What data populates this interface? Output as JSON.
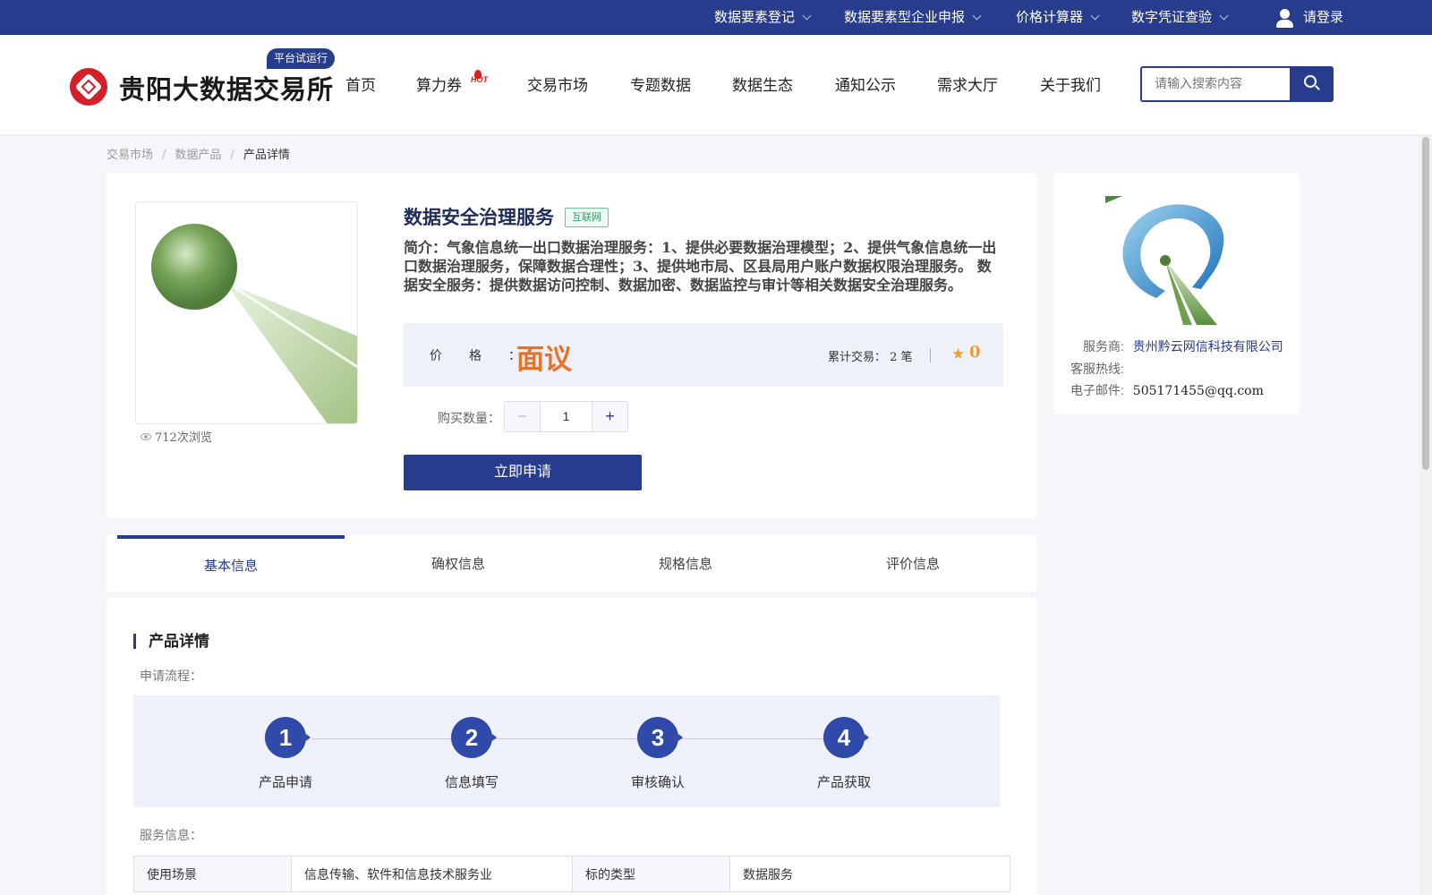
{
  "topbar": {
    "items": [
      {
        "label": "数据要素登记"
      },
      {
        "label": "数据要素型企业申报"
      },
      {
        "label": "价格计算器"
      },
      {
        "label": "数字凭证查验"
      }
    ],
    "login": "请登录"
  },
  "header": {
    "logo_text": "贵阳大数据交易所",
    "trial_badge": "平台试运行",
    "nav": [
      "首页",
      "算力券",
      "交易市场",
      "专题数据",
      "数据生态",
      "通知公示",
      "需求大厅",
      "关于我们"
    ],
    "hot_tag": "HOT",
    "search_placeholder": "请输入搜索内容"
  },
  "breadcrumb": [
    "交易市场",
    "数据产品",
    "产品详情"
  ],
  "product": {
    "title": "数据安全治理服务",
    "tag": "互联网",
    "description": "简介：气象信息统一出口数据治理服务：1、提供必要数据治理模型；2、提供气象信息统一出口数据治理服务，保障数据合理性；3、提供地市局、区县局用户账户数据权限治理服务。 数据安全服务：提供数据访问控制、数据加密、数据监控与审计等相关数据安全治理服务。",
    "price_label": "价格：",
    "price_value": "面议",
    "trade_count": "累计交易：  2 笔",
    "rating": "0",
    "qty_label": "购买数量：",
    "qty_value": "1",
    "views": "712次浏览",
    "apply_button": "立即申请"
  },
  "provider": {
    "name_label": "服务商:",
    "name": "贵州黔云网信科技有限公司",
    "hotline_label": "客服热线:",
    "hotline": "",
    "email_label": "电子邮件:",
    "email": "505171455@qq.com"
  },
  "tabs": [
    {
      "label": "基本信息",
      "active": true
    },
    {
      "label": "确权信息",
      "active": false
    },
    {
      "label": "规格信息",
      "active": false
    },
    {
      "label": "评价信息",
      "active": false
    }
  ],
  "detail": {
    "section_title": "产品详情",
    "flow_label": "申请流程：",
    "steps": [
      {
        "num": "1",
        "label": "产品申请"
      },
      {
        "num": "2",
        "label": "信息填写"
      },
      {
        "num": "3",
        "label": "审核确认"
      },
      {
        "num": "4",
        "label": "产品获取"
      }
    ],
    "service_label": "服务信息：",
    "service_table": [
      {
        "k1": "使用场景",
        "v1": "信息传输、软件和信息技术服务业",
        "k2": "标的类型",
        "v2": "数据服务"
      }
    ]
  },
  "colors": {
    "brand": "#273c8c",
    "price": "#e8722c",
    "logo_red": "#d4202a"
  }
}
